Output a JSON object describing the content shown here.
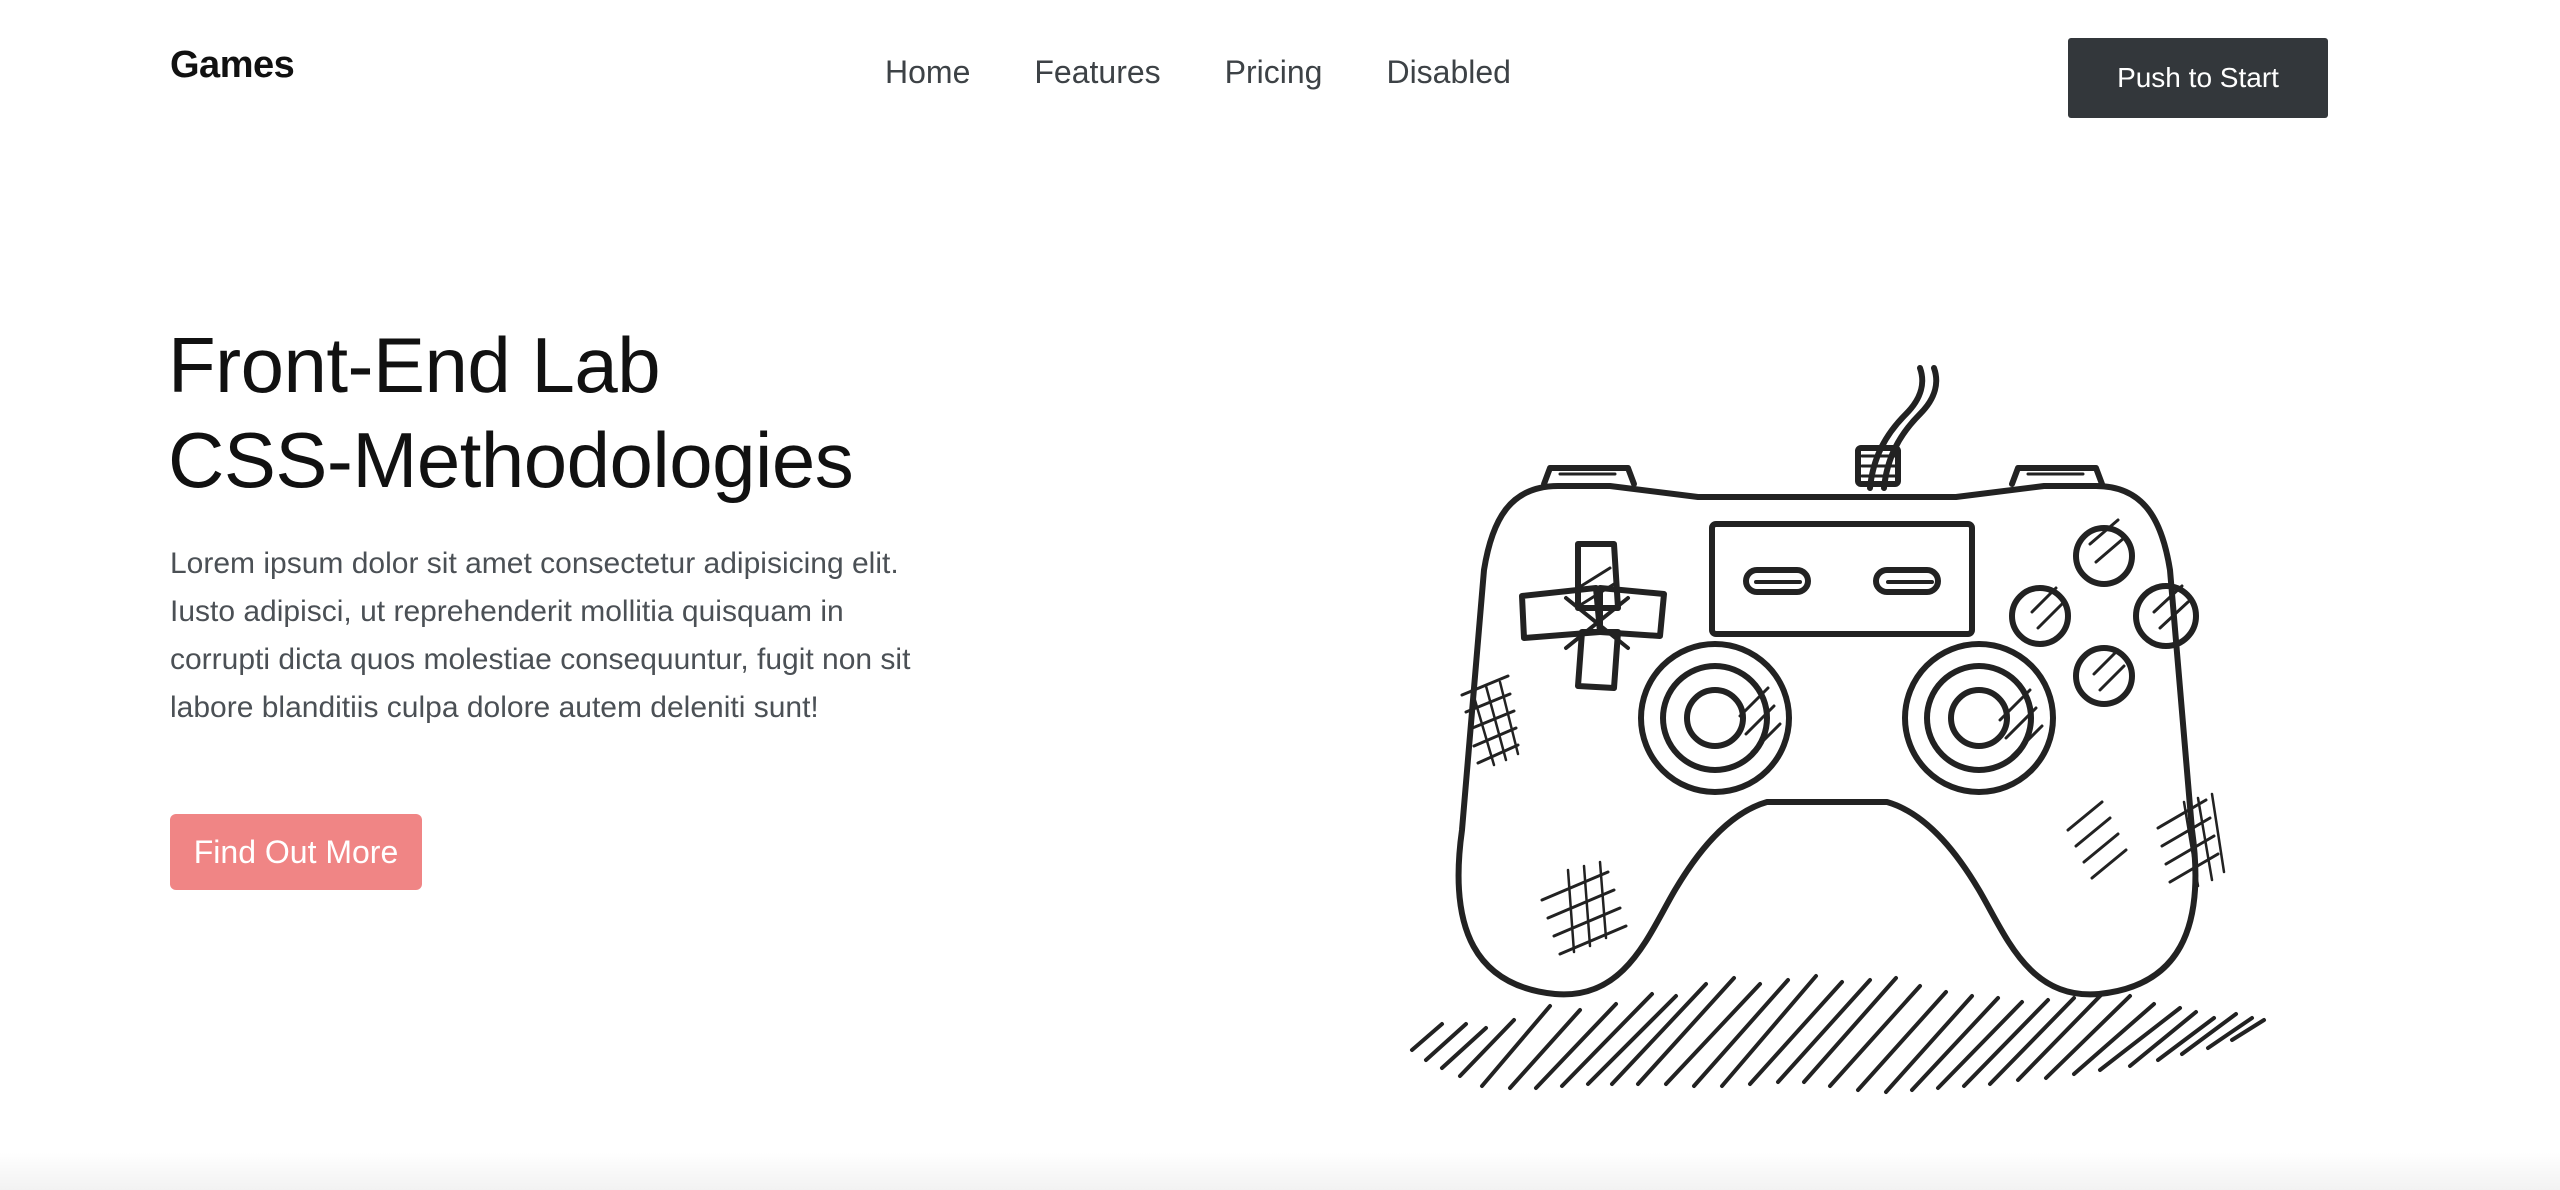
{
  "header": {
    "brand": "Games",
    "nav_items": [
      "Home",
      "Features",
      "Pricing",
      "Disabled"
    ],
    "cta": "Push to Start"
  },
  "hero": {
    "title_line_1": "Front-End Lab",
    "title_line_2": "CSS-Methodologies",
    "description": "Lorem ipsum dolor sit amet consectetur adipisicing elit. Iusto adipisci, ut reprehenderit mollitia quisquam in corrupti dicta quos molestiae consequuntur, fugit non sit labore blanditiis culpa dolore autem deleniti sunt!",
    "button_label": "Find Out More"
  },
  "illustration": {
    "icon": "gamepad-icon",
    "stroke_color": "#222222"
  },
  "colors": {
    "primary": "#33373b",
    "accent": "#f08585",
    "text": "#4b5055"
  }
}
